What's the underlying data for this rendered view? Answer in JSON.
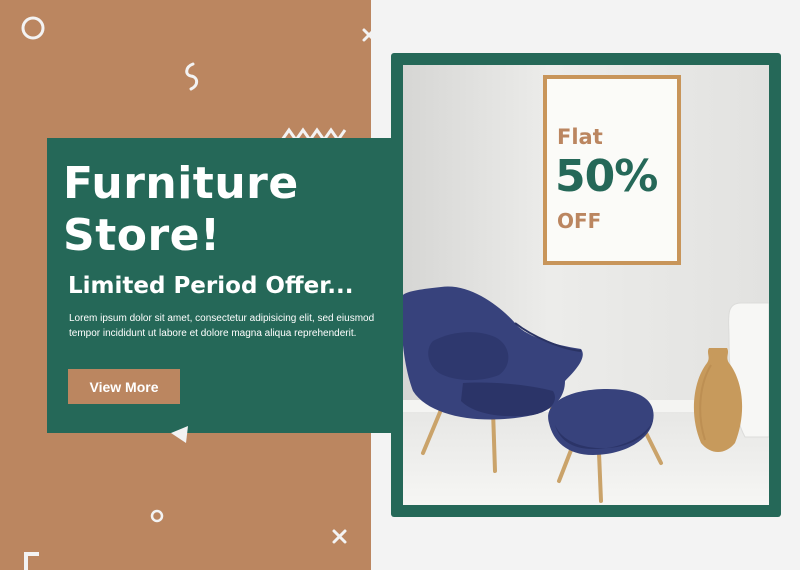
{
  "promo": {
    "headline_line1": "Furniture",
    "headline_line2": "Store!",
    "subheadline": "Limited Period Offer...",
    "body": "Lorem ipsum dolor sit amet, consectetur adipisicing elit, sed eiusmod tempor incididunt ut labore et dolore magna aliqua reprehenderit.",
    "cta_label": "View More"
  },
  "poster": {
    "line1": "Flat",
    "line2": "50%",
    "line3": "OFF"
  },
  "colors": {
    "brand_green": "#256858",
    "brand_tan": "#bb8660",
    "page_background": "#f3f3f3"
  }
}
